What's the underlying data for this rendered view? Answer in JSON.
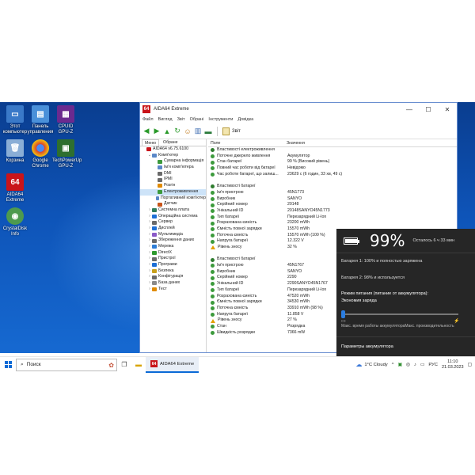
{
  "desktop": {
    "icons": [
      {
        "label": "Этот компьютер",
        "color": "#3a79c8"
      },
      {
        "label": "Панель управления",
        "color": "#4a90d9"
      },
      {
        "label": "CPUID GPU-Z",
        "color": "#6b2a8f"
      },
      {
        "label": "Корзина",
        "color": "#8aaed6"
      },
      {
        "label": "Google Chrome",
        "color": "#d8432f"
      },
      {
        "label": "TechPowerUp GPU-Z",
        "color": "#2e6f2e"
      },
      {
        "label": "AIDA64 Extreme",
        "color": "#c9141a",
        "glyph": "64"
      },
      {
        "label": "CrystalDisk Info",
        "color": "#4e9a4e"
      }
    ]
  },
  "window": {
    "title": "AIDA64 Extreme",
    "menu": [
      "Файл",
      "Вигляд",
      "Звіт",
      "Обрані",
      "Інструменти",
      "Довідка"
    ],
    "toolbar_report": "Звіт",
    "left_tabs": [
      "Меню",
      "Обране"
    ],
    "tree": [
      {
        "label": "AIDA64 v6.75.6100",
        "indent": 0,
        "color": "#c9141a",
        "twisty": ""
      },
      {
        "label": "Комп'ютер",
        "indent": 1,
        "color": "#5a88c8",
        "twisty": "⌄"
      },
      {
        "label": "Сумарна інформація",
        "indent": 2,
        "color": "#3c9a3c",
        "twisty": ""
      },
      {
        "label": "Ім'я комп'ютера",
        "indent": 2,
        "color": "#5a88c8",
        "twisty": ""
      },
      {
        "label": "DMI",
        "indent": 2,
        "color": "#6a6a6a",
        "twisty": ""
      },
      {
        "label": "IPMI",
        "indent": 2,
        "color": "#6a6a6a",
        "twisty": ""
      },
      {
        "label": "Розгін",
        "indent": 2,
        "color": "#e08a00",
        "twisty": ""
      },
      {
        "label": "Електроживлення",
        "indent": 2,
        "color": "#3c9a3c",
        "twisty": "",
        "selected": true
      },
      {
        "label": "Портативний комп'ютер",
        "indent": 2,
        "color": "#5a88c8",
        "twisty": ""
      },
      {
        "label": "Датчик",
        "indent": 2,
        "color": "#c8541a",
        "twisty": ""
      },
      {
        "label": "Системна плата",
        "indent": 1,
        "color": "#2e7d5a",
        "twisty": "›"
      },
      {
        "label": "Операційна система",
        "indent": 1,
        "color": "#1d6fd6",
        "twisty": "›"
      },
      {
        "label": "Сервер",
        "indent": 1,
        "color": "#6a6a6a",
        "twisty": "›"
      },
      {
        "label": "Дисплей",
        "indent": 1,
        "color": "#1d6fd6",
        "twisty": "›"
      },
      {
        "label": "Мультимедіа",
        "indent": 1,
        "color": "#8a5ac8",
        "twisty": "›"
      },
      {
        "label": "Збереження даних",
        "indent": 1,
        "color": "#6a6a6a",
        "twisty": "›"
      },
      {
        "label": "Мережа",
        "indent": 1,
        "color": "#2e7dd6",
        "twisty": "›"
      },
      {
        "label": "DirectX",
        "indent": 1,
        "color": "#2e9a2e",
        "twisty": "›"
      },
      {
        "label": "Пристрої",
        "indent": 1,
        "color": "#6a6a6a",
        "twisty": "›"
      },
      {
        "label": "Програми",
        "indent": 1,
        "color": "#1d6fd6",
        "twisty": "›"
      },
      {
        "label": "Безпека",
        "indent": 1,
        "color": "#c8a01a",
        "twisty": "›"
      },
      {
        "label": "Конфігурація",
        "indent": 1,
        "color": "#6a6a6a",
        "twisty": "›"
      },
      {
        "label": "База даних",
        "indent": 1,
        "color": "#8a8a8a",
        "twisty": "›"
      },
      {
        "label": "Тест",
        "indent": 1,
        "color": "#e08a00",
        "twisty": "›"
      }
    ],
    "columns": {
      "field": "Поле",
      "value": "Значення"
    },
    "rows": [
      {
        "type": "sec",
        "field": "Властивості електроживлення",
        "value": ""
      },
      {
        "type": "row",
        "field": "Поточне джерело живлення",
        "value": "Акумулятор"
      },
      {
        "type": "row",
        "field": "Стан батареї",
        "value": "99 % (Високий рівень)"
      },
      {
        "type": "row",
        "field": "Повний час роботи від батареї",
        "value": "Невідомо"
      },
      {
        "type": "row",
        "field": "Час роботи батареї, що залиш...",
        "value": "23629 с (6 годин, 33 хв, 49 с)"
      },
      {
        "type": "gap"
      },
      {
        "type": "sec",
        "field": "Властивості батареї",
        "value": ""
      },
      {
        "type": "row",
        "field": "Ім'я пристрою",
        "value": "45N1773"
      },
      {
        "type": "row",
        "field": "Виробник",
        "value": "SANYO"
      },
      {
        "type": "row",
        "field": "Серійний номер",
        "value": "20148"
      },
      {
        "type": "row",
        "field": "Унікальний ID",
        "value": "20148SANYO45N1773"
      },
      {
        "type": "row",
        "field": "Тип батареї",
        "value": "Перезарядний Li-Ion"
      },
      {
        "type": "row",
        "field": "Розрахована ємність",
        "value": "23200 mWh"
      },
      {
        "type": "row",
        "field": "Ємність повної зарядки",
        "value": "15570 mWh"
      },
      {
        "type": "row",
        "field": "Поточна ємність",
        "value": "15570 mWh  (100 %)"
      },
      {
        "type": "row",
        "field": "Напруга батареї",
        "value": "12.322 V"
      },
      {
        "type": "warn",
        "field": "Рівень зносу",
        "value": "32 %"
      },
      {
        "type": "gap"
      },
      {
        "type": "sec",
        "field": "Властивості батареї",
        "value": ""
      },
      {
        "type": "row",
        "field": "Ім'я пристрою",
        "value": "45N1767"
      },
      {
        "type": "row",
        "field": "Виробник",
        "value": "SANYO"
      },
      {
        "type": "row",
        "field": "Серійний номер",
        "value": "2290"
      },
      {
        "type": "row",
        "field": "Унікальний ID",
        "value": "2290SANYO45N1767"
      },
      {
        "type": "row",
        "field": "Тип батареї",
        "value": "Перезарядний Li-Ion"
      },
      {
        "type": "row",
        "field": "Розрахована ємність",
        "value": "47520 mWh"
      },
      {
        "type": "row",
        "field": "Ємність повної зарядки",
        "value": "34530 mWh"
      },
      {
        "type": "row",
        "field": "Поточна ємність",
        "value": "33910 mWh  (98 %)"
      },
      {
        "type": "row",
        "field": "Напруга батареї",
        "value": "11.858 V"
      },
      {
        "type": "warn",
        "field": "Рівень зносу",
        "value": "27 %"
      },
      {
        "type": "row",
        "field": "Стан",
        "value": "Розрядка"
      },
      {
        "type": "row",
        "field": "Швидкість розрядки",
        "value": "7366 mW"
      }
    ]
  },
  "flyout": {
    "percent_text": "99%",
    "battery_level": 0.99,
    "remaining": "Осталось 6 ч 33 мин",
    "battery1": "Батарея 1: 100% и полностью заряжена",
    "battery2": "Батарея 2: 98% и используется",
    "mode_title": "Режим питания (питание от аккумулятора):",
    "mode_value": "Экономия заряда",
    "slider_left": "Макс. время работы аккумулятора",
    "slider_right": "Макс. производительность",
    "settings_link": "Параметры аккумулятора"
  },
  "taskbar": {
    "search_placeholder": "Поиск",
    "app_label": "AIDA64 Extreme",
    "app_badge": "64",
    "weather": "1°C  Cloudy",
    "lang": "РУС",
    "time": "11:10",
    "date": "21.03.2023"
  }
}
